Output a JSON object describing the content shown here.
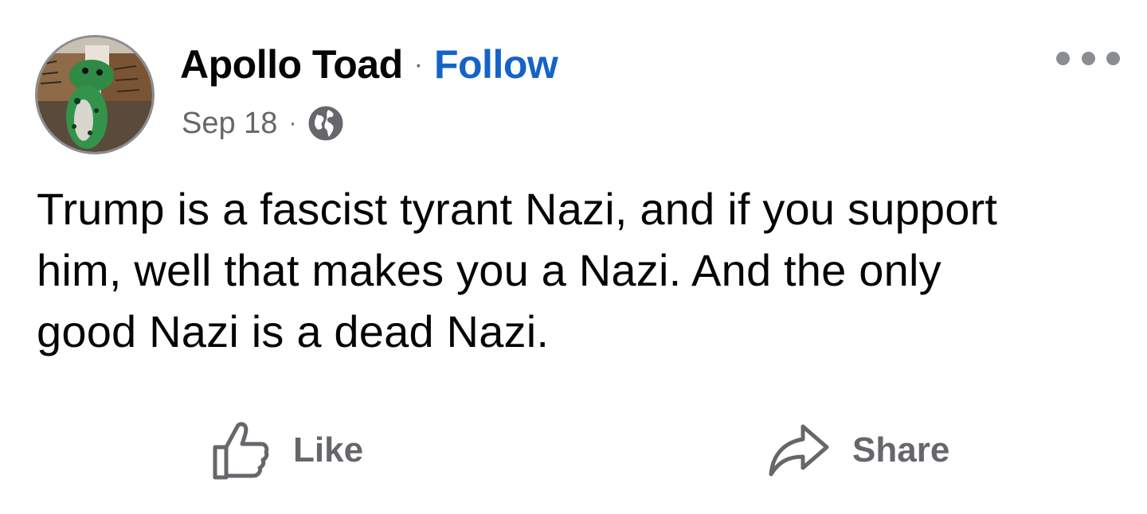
{
  "post": {
    "author": "Apollo Toad",
    "separator": "·",
    "follow_label": "Follow",
    "date": "Sep 18",
    "meta_separator": "·",
    "privacy_icon": "globe-icon",
    "more_icon": "more-options-icon",
    "body_lines": [
      "Trump is a fascist tyrant Nazi, and if you support",
      "him, well that makes you a Nazi. And the only",
      "good Nazi is a dead Nazi."
    ],
    "actions": {
      "like_label": "Like",
      "like_icon": "thumbs-up-icon",
      "share_label": "Share",
      "share_icon": "share-arrow-icon"
    }
  },
  "colors": {
    "link": "#1663c7",
    "secondary_text": "#65676b",
    "primary_text": "#050505",
    "icon_gray": "#8a8d91"
  }
}
